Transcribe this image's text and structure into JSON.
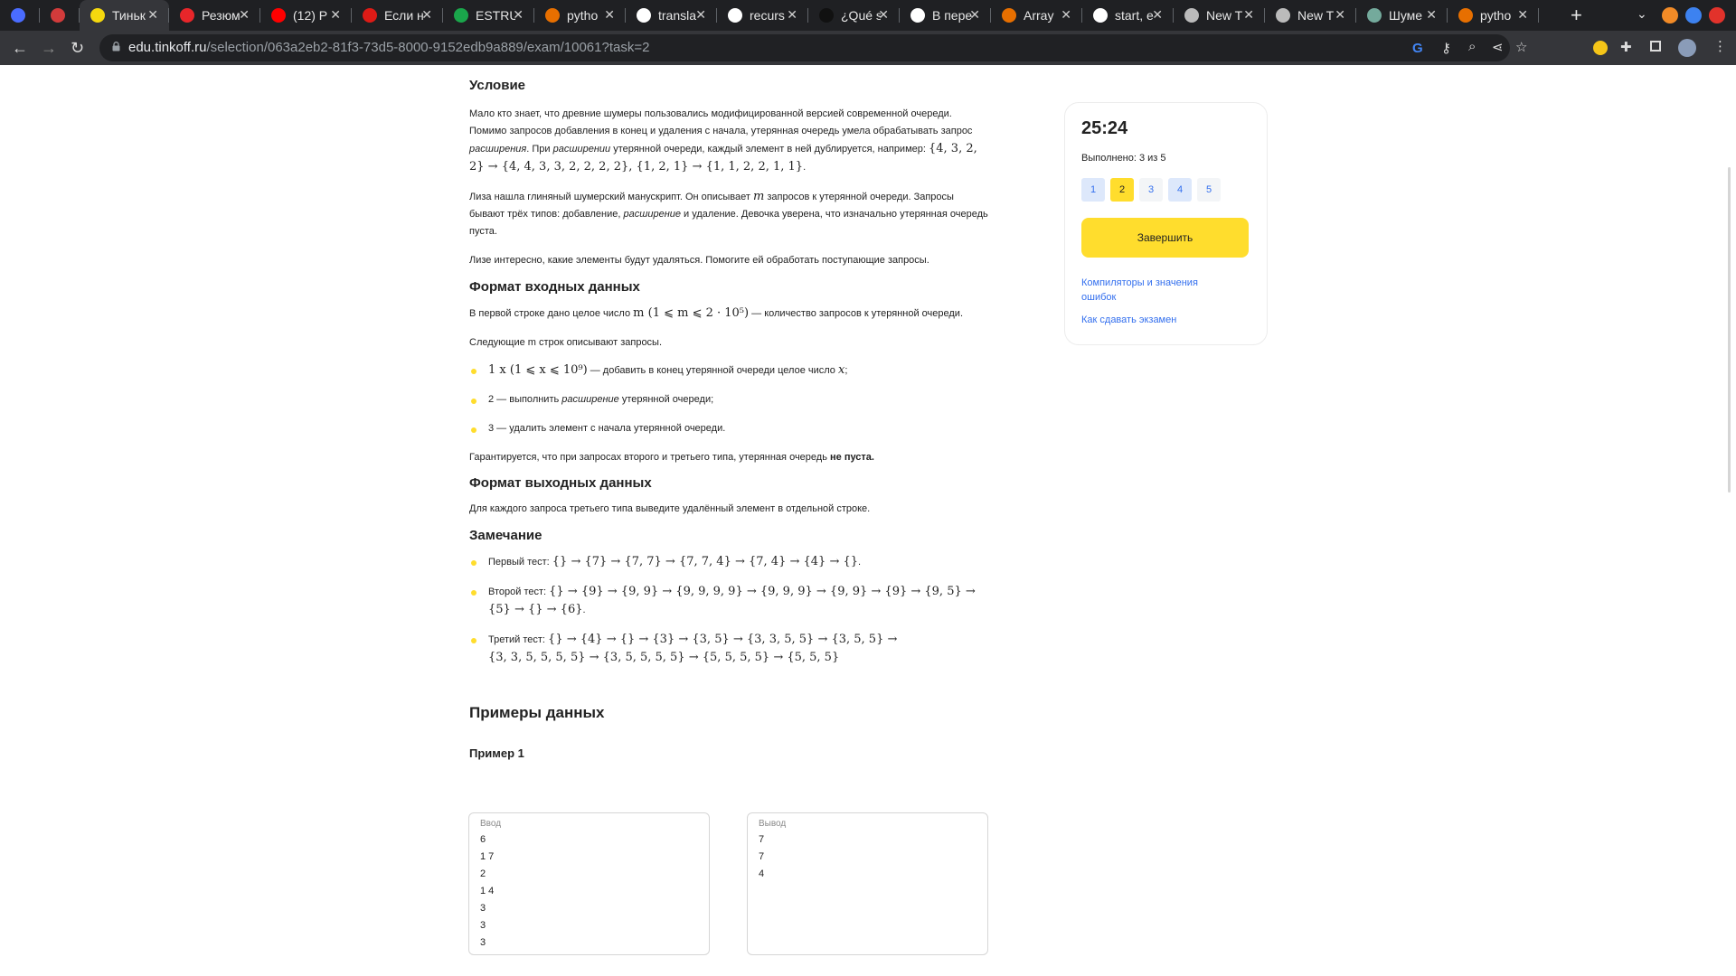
{
  "browser": {
    "tabs": [
      {
        "title": "",
        "icon": "chrome-circle-icon",
        "color": "#4a6cff",
        "small": true
      },
      {
        "title": "",
        "icon": "red-square-icon",
        "color": "#d23b3b",
        "small": true
      },
      {
        "title": "Тиньк",
        "icon": "tinkoff-shield-icon",
        "color": "#f5d80e",
        "active": true
      },
      {
        "title": "Резюм",
        "icon": "hh-icon",
        "color": "#e8262a"
      },
      {
        "title": "(12) Р",
        "icon": "youtube-icon",
        "color": "#ff0000"
      },
      {
        "title": "Если н",
        "icon": "angular-icon",
        "color": "#dd1b16"
      },
      {
        "title": "ESTRU",
        "icon": "uv-icon",
        "color": "#1aa64b"
      },
      {
        "title": "pytho",
        "icon": "java-cup-icon",
        "color": "#e76f00"
      },
      {
        "title": "transla",
        "icon": "google-icon",
        "color": "#ffffff"
      },
      {
        "title": "recurs",
        "icon": "google-icon",
        "color": "#ffffff"
      },
      {
        "title": "¿Qué s",
        "icon": "dark-app-icon",
        "color": "#111111"
      },
      {
        "title": "В пере",
        "icon": "google-icon",
        "color": "#ffffff"
      },
      {
        "title": "Array",
        "icon": "java-cup-icon",
        "color": "#e76f00"
      },
      {
        "title": "start, e",
        "icon": "google-icon",
        "color": "#ffffff"
      },
      {
        "title": "New T",
        "icon": "chrome-icon",
        "color": "#bbbbbb"
      },
      {
        "title": "New T",
        "icon": "chrome-icon",
        "color": "#bbbbbb"
      },
      {
        "title": "Шуме",
        "icon": "openai-icon",
        "color": "#74aa9c"
      },
      {
        "title": "pytho",
        "icon": "java-cup-icon",
        "color": "#e76f00"
      }
    ],
    "url_domain": "edu.tinkoff.ru",
    "url_path": "/selection/063a2eb2-81f3-73d5-8000-9152edb9a889/exam/10061?task=2"
  },
  "problem": {
    "condition_title": "Условие",
    "para1_a": "Мало кто знает, что древние шумеры пользовались модифицированной версией современной очереди. Помимо запросов добавления в конец и удаления с начала, утерянная очередь умела обрабатывать запрос ",
    "para1_em1": "расширения",
    "para1_b": ". При ",
    "para1_em2": "расширении",
    "para1_c": " утерянной очереди, каждый элемент в ней дублируется, например: ",
    "para1_math": "{4, 3, 2, 2} → {4, 4, 3, 3, 2, 2, 2, 2}, {1, 2, 1} → {1, 1, 2, 2, 1, 1}",
    "para1_end": ".",
    "para2_a": "Лиза нашла глиняный шумерский манускрипт. Он описывает ",
    "para2_m": "m",
    "para2_b": " запросов к утерянной очереди. Запросы бывают трёх типов: добавление, ",
    "para2_em": "расширение",
    "para2_c": " и удаление. Девочка уверена, что изначально утерянная очередь пуста.",
    "para3": "Лизе интересно, какие элементы будут удаляться. Помогите ей обработать поступающие запросы.",
    "input_title": "Формат входных данных",
    "input_a": "В первой строке дано целое число ",
    "input_math": "m (1 ⩽ m ⩽ 2 · 10⁵)",
    "input_b": " — количество запросов к утерянной очереди.",
    "input_next": "Следующие m строк описывают запросы.",
    "b1_math": "1 x (1 ⩽ x ⩽ 10⁹)",
    "b1_text": " — добавить в конец утерянной очереди целое число ",
    "b1_x": "x",
    "b1_end": ";",
    "b2_a": "2 — выполнить ",
    "b2_em": "расширение",
    "b2_b": " утерянной очереди;",
    "b3": "3 — удалить элемент с начала утерянной очереди.",
    "guarantee_a": "Гарантируется, что при запросах второго и третьего типа, утерянная очередь ",
    "guarantee_b": "не пуста.",
    "output_title": "Формат выходных данных",
    "output_text": "Для каждого запроса третьего типа выведите удалённый элемент в отдельной строке.",
    "note_title": "Замечание",
    "n1_label": "Первый тест: ",
    "n1_math": "{} → {7} → {7, 7} → {7, 7, 4} → {7, 4} → {4} → {}",
    "n1_end": ".",
    "n2_label": "Второй тест: ",
    "n2_math1": "{} → {9} → {9, 9} → {9, 9, 9, 9} → {9, 9, 9} → {9, 9} → {9} → {9, 5} →",
    "n2_math2": "{5} → {} → {6}",
    "n2_end": ".",
    "n3_label": "Третий тест: ",
    "n3_math1": "{} → {4} → {} → {3} → {3, 5} → {3, 3, 5, 5} → {3, 5, 5} →",
    "n3_math2": "{3, 3, 5, 5, 5, 5} → {3, 5, 5, 5, 5} → {5, 5, 5, 5} → {5, 5, 5}",
    "examples_title": "Примеры данных",
    "example1_title": "Пример 1",
    "input_caption": "Ввод",
    "input_lines": [
      "6",
      "1 7",
      "2",
      "1 4",
      "3",
      "3",
      "3"
    ],
    "output_caption": "Вывод",
    "output_lines": [
      "7",
      "7",
      "4"
    ]
  },
  "sidebar": {
    "timer": "25:24",
    "done": "Выполнено: 3 из 5",
    "pages": [
      {
        "label": "1",
        "state": "done"
      },
      {
        "label": "2",
        "state": "current"
      },
      {
        "label": "3",
        "state": "empty"
      },
      {
        "label": "4",
        "state": "done"
      },
      {
        "label": "5",
        "state": "empty"
      }
    ],
    "finish_label": "Завершить",
    "link1": "Компиляторы и значения ошибок",
    "link2": "Как сдавать экзамен",
    "colors": {
      "accent": "#ffdd2d",
      "done_bg": "#dde8fb",
      "empty_bg": "#f3f5f7",
      "link": "#336fee"
    }
  }
}
